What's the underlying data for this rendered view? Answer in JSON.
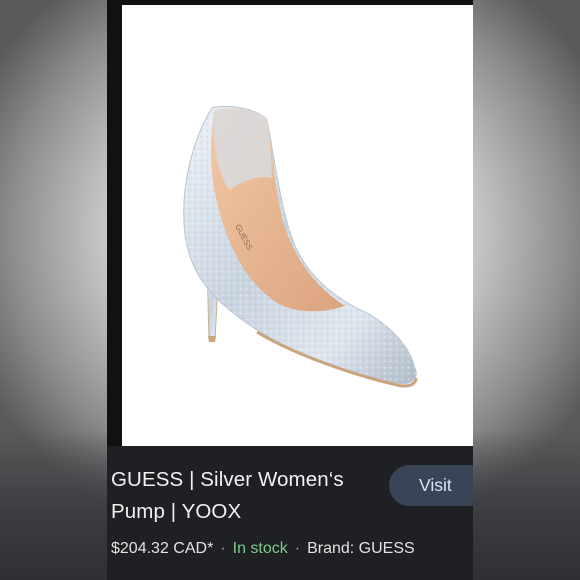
{
  "product": {
    "title_line1": "GUESS | Silver Women‘s",
    "title_line2": "Pump | YOOX",
    "price": "$204.32 CAD*",
    "stock": "In stock",
    "brand": "Brand: GUESS",
    "separator": "·",
    "image_label": "GUESS"
  },
  "actions": {
    "visit_label": "Visit"
  },
  "colors": {
    "card_bg": "#1f2023",
    "visit_bg": "#394457",
    "visit_text": "#d6e3fb",
    "stock_green": "#7bc98c",
    "shoe_silver": "#cfd8e4",
    "shoe_lining": "#e8b58f"
  }
}
